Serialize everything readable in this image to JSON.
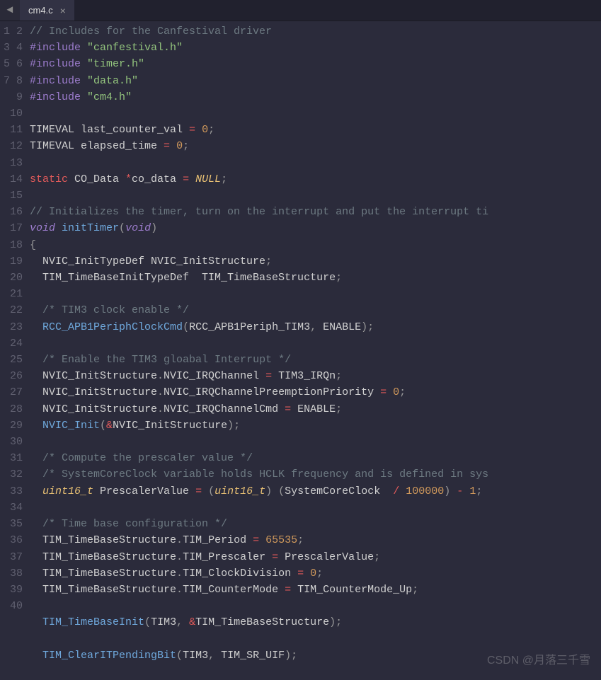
{
  "tab": {
    "label": "cm4.c",
    "prev_icon": "◄"
  },
  "gutter_lines": 40,
  "watermark": "CSDN @月落三千雪",
  "code": [
    [
      [
        "comment",
        "// Includes for the Canfestival driver"
      ]
    ],
    [
      [
        "preproc",
        "#include "
      ],
      [
        "string",
        "\"canfestival.h\""
      ]
    ],
    [
      [
        "preproc",
        "#include "
      ],
      [
        "string",
        "\"timer.h\""
      ]
    ],
    [
      [
        "preproc",
        "#include "
      ],
      [
        "string",
        "\"data.h\""
      ]
    ],
    [
      [
        "preproc",
        "#include "
      ],
      [
        "string",
        "\"cm4.h\""
      ]
    ],
    [],
    [
      [
        "text",
        "TIMEVAL last_counter_val "
      ],
      [
        "op",
        "="
      ],
      [
        "text",
        " "
      ],
      [
        "num",
        "0"
      ],
      [
        "punct",
        ";"
      ]
    ],
    [
      [
        "text",
        "TIMEVAL elapsed_time "
      ],
      [
        "op",
        "="
      ],
      [
        "text",
        " "
      ],
      [
        "num",
        "0"
      ],
      [
        "punct",
        ";"
      ]
    ],
    [],
    [
      [
        "static",
        "static"
      ],
      [
        "text",
        " CO_Data "
      ],
      [
        "op",
        "*"
      ],
      [
        "text",
        "co_data "
      ],
      [
        "op",
        "="
      ],
      [
        "text",
        " "
      ],
      [
        "null",
        "NULL"
      ],
      [
        "punct",
        ";"
      ]
    ],
    [],
    [
      [
        "comment",
        "// Initializes the timer, turn on the interrupt and put the interrupt ti"
      ]
    ],
    [
      [
        "keyword",
        "void"
      ],
      [
        "text",
        " "
      ],
      [
        "func",
        "initTimer"
      ],
      [
        "punct",
        "("
      ],
      [
        "keyword",
        "void"
      ],
      [
        "punct",
        ")"
      ]
    ],
    [
      [
        "punct",
        "{"
      ]
    ],
    [
      [
        "text",
        "  NVIC_InitTypeDef NVIC_InitStructure"
      ],
      [
        "punct",
        ";"
      ]
    ],
    [
      [
        "text",
        "  TIM_TimeBaseInitTypeDef  TIM_TimeBaseStructure"
      ],
      [
        "punct",
        ";"
      ]
    ],
    [],
    [
      [
        "text",
        "  "
      ],
      [
        "comment",
        "/* TIM3 clock enable */"
      ]
    ],
    [
      [
        "text",
        "  "
      ],
      [
        "func",
        "RCC_APB1PeriphClockCmd"
      ],
      [
        "punct",
        "("
      ],
      [
        "text",
        "RCC_APB1Periph_TIM3"
      ],
      [
        "punct",
        ","
      ],
      [
        "text",
        " ENABLE"
      ],
      [
        "punct",
        ");"
      ]
    ],
    [],
    [
      [
        "text",
        "  "
      ],
      [
        "comment",
        "/* Enable the TIM3 gloabal Interrupt */"
      ]
    ],
    [
      [
        "text",
        "  NVIC_InitStructure"
      ],
      [
        "punct",
        "."
      ],
      [
        "text",
        "NVIC_IRQChannel "
      ],
      [
        "op",
        "="
      ],
      [
        "text",
        " TIM3_IRQn"
      ],
      [
        "punct",
        ";"
      ]
    ],
    [
      [
        "text",
        "  NVIC_InitStructure"
      ],
      [
        "punct",
        "."
      ],
      [
        "text",
        "NVIC_IRQChannelPreemptionPriority "
      ],
      [
        "op",
        "="
      ],
      [
        "text",
        " "
      ],
      [
        "num",
        "0"
      ],
      [
        "punct",
        ";"
      ]
    ],
    [
      [
        "text",
        "  NVIC_InitStructure"
      ],
      [
        "punct",
        "."
      ],
      [
        "text",
        "NVIC_IRQChannelCmd "
      ],
      [
        "op",
        "="
      ],
      [
        "text",
        " ENABLE"
      ],
      [
        "punct",
        ";"
      ]
    ],
    [
      [
        "text",
        "  "
      ],
      [
        "func",
        "NVIC_Init"
      ],
      [
        "punct",
        "("
      ],
      [
        "op",
        "&"
      ],
      [
        "text",
        "NVIC_InitStructure"
      ],
      [
        "punct",
        ");"
      ]
    ],
    [],
    [
      [
        "text",
        "  "
      ],
      [
        "comment",
        "/* Compute the prescaler value */"
      ]
    ],
    [
      [
        "text",
        "  "
      ],
      [
        "comment",
        "/* SystemCoreClock variable holds HCLK frequency and is defined in sys"
      ]
    ],
    [
      [
        "text",
        "  "
      ],
      [
        "type",
        "uint16_t"
      ],
      [
        "text",
        " PrescalerValue "
      ],
      [
        "op",
        "="
      ],
      [
        "text",
        " "
      ],
      [
        "punct",
        "("
      ],
      [
        "type",
        "uint16_t"
      ],
      [
        "punct",
        ")"
      ],
      [
        "text",
        " "
      ],
      [
        "punct",
        "("
      ],
      [
        "text",
        "SystemCoreClock  "
      ],
      [
        "op",
        "/"
      ],
      [
        "text",
        " "
      ],
      [
        "num",
        "100000"
      ],
      [
        "punct",
        ")"
      ],
      [
        "text",
        " "
      ],
      [
        "op",
        "-"
      ],
      [
        "text",
        " "
      ],
      [
        "num",
        "1"
      ],
      [
        "punct",
        ";"
      ]
    ],
    [],
    [
      [
        "text",
        "  "
      ],
      [
        "comment",
        "/* Time base configuration */"
      ]
    ],
    [
      [
        "text",
        "  TIM_TimeBaseStructure"
      ],
      [
        "punct",
        "."
      ],
      [
        "text",
        "TIM_Period "
      ],
      [
        "op",
        "="
      ],
      [
        "text",
        " "
      ],
      [
        "num",
        "65535"
      ],
      [
        "punct",
        ";"
      ]
    ],
    [
      [
        "text",
        "  TIM_TimeBaseStructure"
      ],
      [
        "punct",
        "."
      ],
      [
        "text",
        "TIM_Prescaler "
      ],
      [
        "op",
        "="
      ],
      [
        "text",
        " PrescalerValue"
      ],
      [
        "punct",
        ";"
      ]
    ],
    [
      [
        "text",
        "  TIM_TimeBaseStructure"
      ],
      [
        "punct",
        "."
      ],
      [
        "text",
        "TIM_ClockDivision "
      ],
      [
        "op",
        "="
      ],
      [
        "text",
        " "
      ],
      [
        "num",
        "0"
      ],
      [
        "punct",
        ";"
      ]
    ],
    [
      [
        "text",
        "  TIM_TimeBaseStructure"
      ],
      [
        "punct",
        "."
      ],
      [
        "text",
        "TIM_CounterMode "
      ],
      [
        "op",
        "="
      ],
      [
        "text",
        " TIM_CounterMode_Up"
      ],
      [
        "punct",
        ";"
      ]
    ],
    [],
    [
      [
        "text",
        "  "
      ],
      [
        "func",
        "TIM_TimeBaseInit"
      ],
      [
        "punct",
        "("
      ],
      [
        "text",
        "TIM3"
      ],
      [
        "punct",
        ","
      ],
      [
        "text",
        " "
      ],
      [
        "op",
        "&"
      ],
      [
        "text",
        "TIM_TimeBaseStructure"
      ],
      [
        "punct",
        ");"
      ]
    ],
    [],
    [
      [
        "text",
        "  "
      ],
      [
        "func",
        "TIM_ClearITPendingBit"
      ],
      [
        "punct",
        "("
      ],
      [
        "text",
        "TIM3"
      ],
      [
        "punct",
        ","
      ],
      [
        "text",
        " TIM_SR_UIF"
      ],
      [
        "punct",
        ");"
      ]
    ],
    []
  ]
}
